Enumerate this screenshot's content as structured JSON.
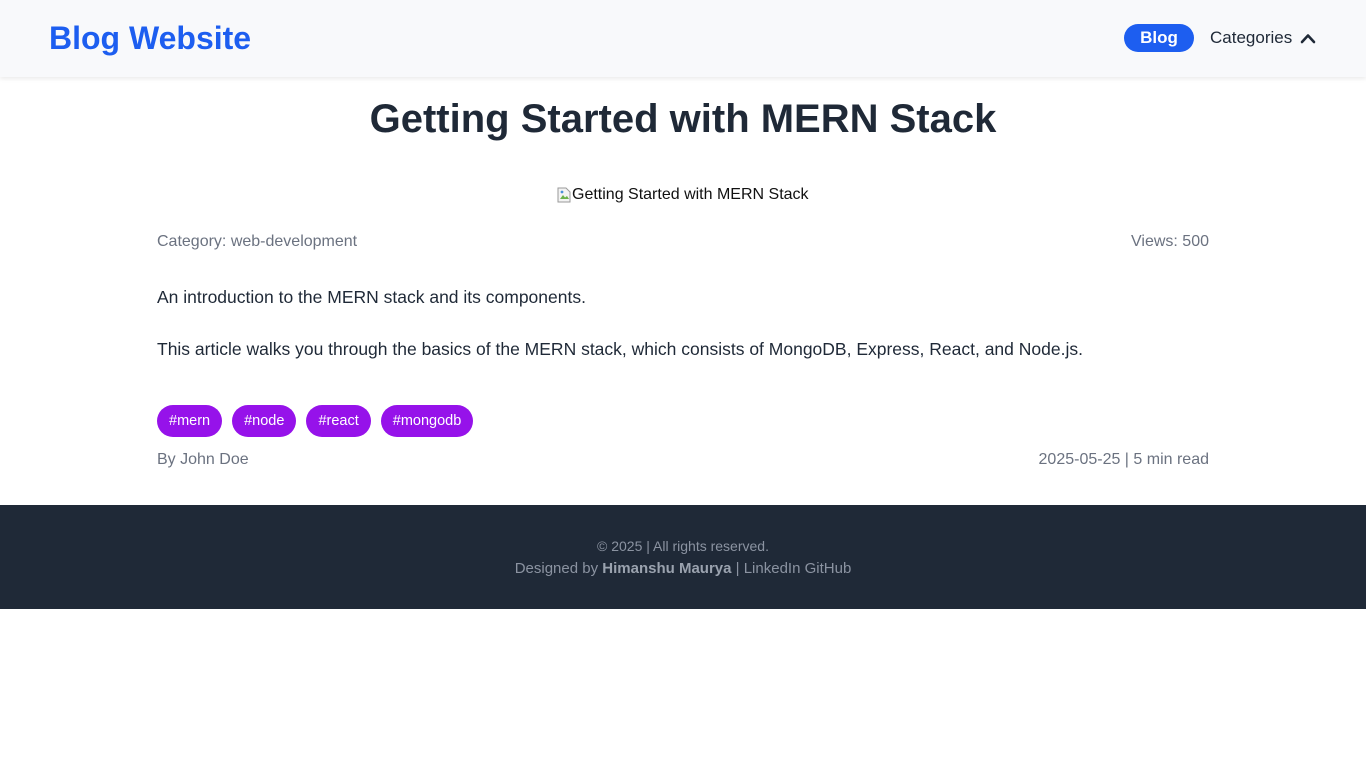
{
  "navbar": {
    "brand": "Blog Website",
    "blog_label": "Blog",
    "categories_label": "Categories",
    "accent_color": "#1d5ef0",
    "categories_icon": "chevron-up-icon"
  },
  "post": {
    "title": "Getting Started with MERN Stack",
    "image_alt": "Getting Started with MERN Stack",
    "category": "Category: web-development",
    "views": "Views: 500",
    "summary": "An introduction to the MERN stack and its components.",
    "content": "This article walks you through the basics of the MERN stack, which consists of MongoDB, Express, React, and Node.js.",
    "tags": [
      "#mern",
      "#node",
      "#react",
      "#mongodb"
    ],
    "tag_color": "#9612ea",
    "author": "By John Doe",
    "date_read": "2025-05-25 | 5 min read"
  },
  "footer": {
    "copyright": "© 2025 | All rights reserved.",
    "designed_by": "Designed by",
    "designer": "Himanshu Maurya",
    "separator": "|",
    "linkedin": "LinkedIn",
    "github": "GitHub",
    "background": "#1f2937"
  }
}
